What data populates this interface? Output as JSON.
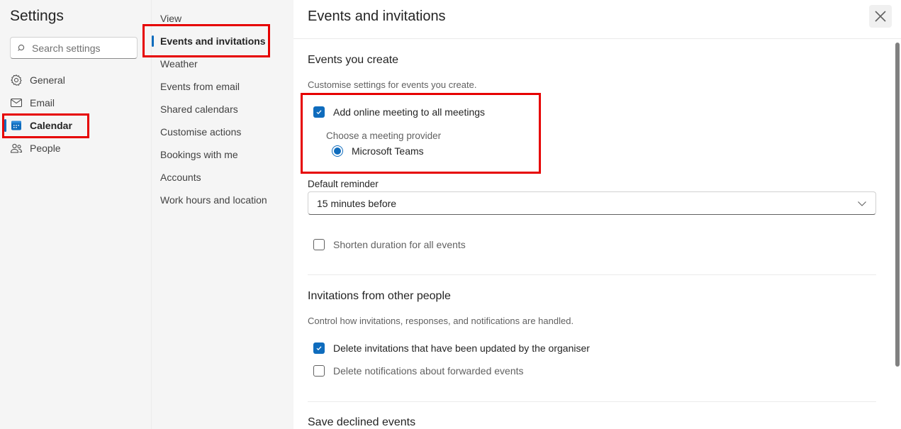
{
  "sidebar": {
    "title": "Settings",
    "search_placeholder": "Search settings",
    "items": [
      {
        "label": "General",
        "icon": "gear-icon"
      },
      {
        "label": "Email",
        "icon": "mail-icon"
      },
      {
        "label": "Calendar",
        "icon": "calendar-icon",
        "active": true
      },
      {
        "label": "People",
        "icon": "people-icon"
      }
    ]
  },
  "subnav": {
    "items": [
      {
        "label": "View"
      },
      {
        "label": "Events and invitations",
        "active": true
      },
      {
        "label": "Weather"
      },
      {
        "label": "Events from email"
      },
      {
        "label": "Shared calendars"
      },
      {
        "label": "Customise actions"
      },
      {
        "label": "Bookings with me"
      },
      {
        "label": "Accounts"
      },
      {
        "label": "Work hours and location"
      }
    ]
  },
  "main": {
    "title": "Events and invitations",
    "close_icon": "close-icon",
    "sections": {
      "events_you_create": {
        "heading": "Events you create",
        "description": "Customise settings for events you create.",
        "add_online_meeting": {
          "label": "Add online meeting to all meetings",
          "checked": true
        },
        "provider_label": "Choose a meeting provider",
        "provider_option": {
          "label": "Microsoft Teams",
          "selected": true
        },
        "default_reminder_label": "Default reminder",
        "default_reminder_value": "15 minutes before",
        "shorten_duration": {
          "label": "Shorten duration for all events",
          "checked": false
        }
      },
      "invitations": {
        "heading": "Invitations from other people",
        "description": "Control how invitations, responses, and notifications are handled.",
        "delete_updated": {
          "label": "Delete invitations that have been updated by the organiser",
          "checked": true
        },
        "delete_forwarded": {
          "label": "Delete notifications about forwarded events",
          "checked": false
        }
      },
      "save_declined": {
        "heading": "Save declined events"
      }
    }
  },
  "colors": {
    "accent": "#0f6cbd",
    "highlight_box": "#e60000",
    "nav_background": "#f5f5f5"
  }
}
